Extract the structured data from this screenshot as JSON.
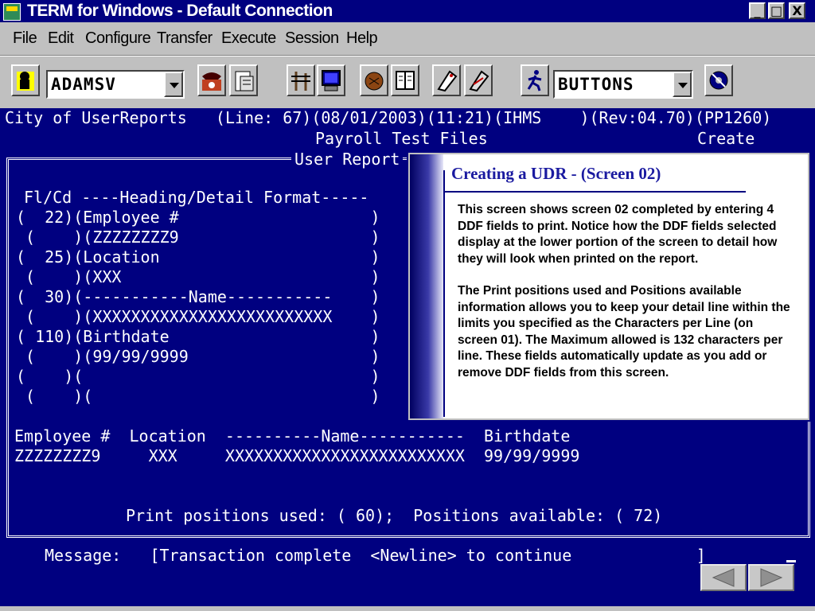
{
  "window": {
    "title": "TERM for Windows - Default Connection",
    "minimize": "_",
    "maximize": "□",
    "close": "X"
  },
  "menu": [
    "File",
    "Edit",
    "Configure",
    "Transfer",
    "Execute",
    "Session",
    "Help"
  ],
  "toolbar": {
    "user_combo_value": "ADAMSV",
    "buttons_combo_value": "BUTTONS"
  },
  "terminal": {
    "header_line": "City of UserReports   (Line: 67)(08/01/2003)(11:21)(IHMS    )(Rev:04.70)(PP1260)",
    "subtitle": "Payroll Test Files",
    "mode": "Create",
    "section_title": "User Report",
    "column_header": "Fl/Cd ----Heading/Detail Format-----",
    "rows": [
      "(  22)(Employee #                    )",
      " (    )(ZZZZZZZZ9                    )",
      "(  25)(Location                      )",
      " (    )(XXX                          )",
      "(  30)(-----------Name-----------    )",
      " (    )(XXXXXXXXXXXXXXXXXXXXXXXXX    )",
      "( 110)(Birthdate                     )",
      " (    )(99/99/9999                   )",
      "(    )(                              )",
      " (    )(                             )"
    ],
    "preview_header": "Employee #  Location  ----------Name-----------  Birthdate",
    "preview_detail": "ZZZZZZZZ9     XXX     XXXXXXXXXXXXXXXXXXXXXXXXX  99/99/9999",
    "positions_line": "Print positions used: ( 60);  Positions available: ( 72)",
    "message_line": "Message:   [Transaction complete  <Newline> to continue             ]"
  },
  "callout": {
    "title": "Creating a UDR -  (Screen 02)",
    "paragraph1": "This screen shows screen 02 completed by entering 4 DDF fields to print.  Notice how the DDF fields selected display at the lower portion of the screen to detail how they will look when printed on the report.",
    "paragraph2": "The Print positions used and Positions available information allows you to keep your detail line within the limits you specified as the Characters per Line (on screen 01).  The Maximum allowed  is 132 characters per line.  These fields automatically update as you add or remove DDF fields from this screen."
  },
  "icons": [
    "phone-icon",
    "clipboard-icon",
    "monitor-icon",
    "book-icon",
    "runner-icon",
    "disk-icon",
    "back-arrow-icon",
    "forward-arrow-icon"
  ]
}
